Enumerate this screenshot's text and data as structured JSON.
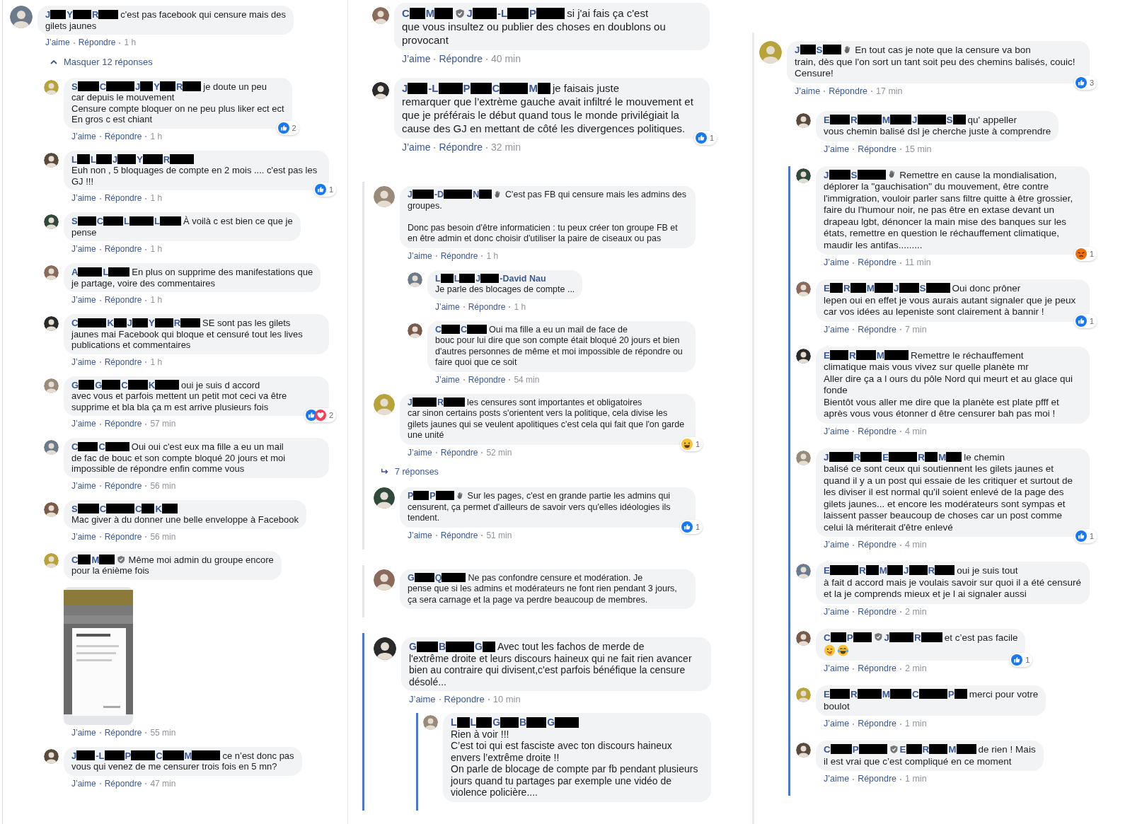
{
  "columns": [
    {
      "items": [
        {
          "kind": "comment",
          "author": [
            {
              "kind": "initial",
              "text": "J"
            },
            {
              "kind": "initial",
              "text": "Y"
            },
            {
              "kind": "initial",
              "text": "R"
            }
          ],
          "head": "c'est pas facebook qui censure mais des",
          "text": "gilets jaunes",
          "actions": {
            "like": "J’aime",
            "reply": "Répondre",
            "time": "1 h"
          },
          "children": [
            {
              "kind": "toggle",
              "expanded": true,
              "label": "Masquer 12 réponses"
            },
            {
              "kind": "comment",
              "author": [
                {
                  "kind": "initial",
                  "text": "S"
                },
                {
                  "kind": "initial",
                  "text": "C"
                },
                {
                  "kind": "initial",
                  "text": "J"
                },
                {
                  "kind": "initial",
                  "text": "Y"
                },
                {
                  "kind": "initial",
                  "text": "R"
                }
              ],
              "head": "je doute un peu",
              "text": "car depuis le mouvement\nCensure compte bloquer on ne peu plus liker ect ect\nEn gros c est chiant",
              "actions": {
                "like": "J’aime",
                "reply": "Répondre",
                "time": "1 h"
              },
              "reaction": {
                "icons": [
                  {
                    "kind": "like"
                  }
                ],
                "count": "2"
              }
            },
            {
              "kind": "comment",
              "author": [
                {
                  "kind": "initial",
                  "text": "L"
                },
                {
                  "kind": "initial",
                  "text": "L"
                },
                {
                  "kind": "initial",
                  "text": "J"
                },
                {
                  "kind": "initial",
                  "text": "Y"
                },
                {
                  "kind": "initial",
                  "text": "R"
                }
              ],
              "text": "Euh non , 5 bloquages de compte en 2 mois .... c'est pas les GJ !!!",
              "actions": {
                "like": "J’aime",
                "reply": "Répondre",
                "time": "1 h"
              },
              "reaction": {
                "icons": [
                  {
                    "kind": "like"
                  }
                ],
                "count": "1"
              }
            },
            {
              "kind": "comment",
              "author": [
                {
                  "kind": "initial",
                  "text": "S"
                },
                {
                  "kind": "initial",
                  "text": "C"
                },
                {
                  "kind": "initial",
                  "text": "L"
                },
                {
                  "kind": "initial",
                  "text": "L"
                }
              ],
              "head": "À voilà c est bien ce que je",
              "text": "pense",
              "actions": {
                "like": "J’aime",
                "reply": "Répondre",
                "time": "1 h"
              }
            },
            {
              "kind": "comment",
              "author": [
                {
                  "kind": "initial",
                  "text": "A"
                },
                {
                  "kind": "initial",
                  "text": "L"
                }
              ],
              "head": "En plus on supprime des manifestations que",
              "text": "je partage, voire des commentaires",
              "actions": {
                "like": "J’aime",
                "reply": "Répondre",
                "time": "1 h"
              }
            },
            {
              "kind": "comment",
              "author": [
                {
                  "kind": "initial",
                  "text": "C"
                },
                {
                  "kind": "initial",
                  "text": "K"
                },
                {
                  "kind": "initial",
                  "text": "J"
                },
                {
                  "kind": "initial",
                  "text": "Y"
                },
                {
                  "kind": "initial",
                  "text": "R"
                }
              ],
              "head": "SE sont pas les gilets",
              "text": "jaunes mai Facebook qui bloque et censuré tout les lives publications et commentaires",
              "actions": {
                "like": "J’aime",
                "reply": "Répondre",
                "time": "1 h"
              }
            },
            {
              "kind": "comment",
              "author": [
                {
                  "kind": "initial",
                  "text": "G"
                },
                {
                  "kind": "initial",
                  "text": "G"
                },
                {
                  "kind": "initial",
                  "text": "C"
                },
                {
                  "kind": "initial",
                  "text": "K"
                }
              ],
              "head": "oui je suis d accord",
              "text": "avec vous et parfois mettent un petit mot ceci va être supprime et bla bla ça m est arrive plusieurs fois",
              "actions": {
                "like": "J’aime",
                "reply": "Répondre",
                "time": "57 min"
              },
              "reaction": {
                "icons": [
                  {
                    "kind": "like"
                  },
                  {
                    "kind": "love"
                  }
                ],
                "count": "2"
              }
            },
            {
              "kind": "comment",
              "author": [
                {
                  "kind": "initial",
                  "text": "C"
                },
                {
                  "kind": "initial",
                  "text": "C"
                }
              ],
              "head": "Oui oui c'est eux ma fille a eu un mail",
              "text": "de fac de bouc et son compte bloqué 20 jours et moi impossible de répondre enfin comme vous",
              "actions": {
                "like": "J’aime",
                "reply": "Répondre",
                "time": "56 min"
              }
            },
            {
              "kind": "comment",
              "author": [
                {
                  "kind": "initial",
                  "text": "S"
                },
                {
                  "kind": "initial",
                  "text": "C"
                },
                {
                  "kind": "initial",
                  "text": "C"
                },
                {
                  "kind": "initial",
                  "text": "K"
                }
              ],
              "text": "Mac giver à du donner une belle enveloppe à Facebook",
              "actions": {
                "like": "J’aime",
                "reply": "Répondre",
                "time": "56 min"
              }
            },
            {
              "kind": "comment",
              "author": [
                {
                  "kind": "initial",
                  "text": "C"
                },
                {
                  "kind": "initial",
                  "text": "M"
                },
                {
                  "kind": "admin"
                }
              ],
              "head": "Même moi admin du groupe encore",
              "text": "pour la énième fois",
              "attachment": {
                "kind": "picture"
              },
              "actions": {
                "like": "J’aime",
                "reply": "Répondre",
                "time": "55 min"
              }
            },
            {
              "kind": "comment",
              "author": [
                {
                  "kind": "initial",
                  "text": "J"
                },
                {
                  "kind": "initial",
                  "text": "-L"
                },
                {
                  "kind": "initial",
                  "text": "P"
                },
                {
                  "kind": "initial",
                  "text": "C"
                },
                {
                  "kind": "initial",
                  "text": "M"
                }
              ],
              "head": "ce n’est donc pas",
              "text": "vous qui venez de me censurer trois fois en 5 mn?",
              "actions": {
                "like": "J’aime",
                "reply": "Répondre",
                "time": "47 min"
              }
            }
          ]
        }
      ]
    },
    {
      "items": [
        {
          "kind": "comment",
          "author": [
            {
              "kind": "initial",
              "text": "C"
            },
            {
              "kind": "initial",
              "text": "M"
            },
            {
              "kind": "admin"
            },
            {
              "kind": "initial",
              "text": "J"
            },
            {
              "kind": "initial",
              "text": "-L"
            },
            {
              "kind": "initial",
              "text": "P"
            }
          ],
          "head": "si j'ai fais ça c'est",
          "text": "que vous insultez ou publier des choses en doublons ou provocant",
          "actions": {
            "like": "J’aime",
            "reply": "Répondre",
            "time": "40 min"
          }
        },
        {
          "kind": "comment",
          "author": [
            {
              "kind": "initial",
              "text": "J"
            },
            {
              "kind": "initial",
              "text": "-L"
            },
            {
              "kind": "initial",
              "text": "P"
            },
            {
              "kind": "initial",
              "text": "C"
            },
            {
              "kind": "initial",
              "text": "M"
            }
          ],
          "head": "je faisais juste",
          "text": "remarquer que l’extrème gauche avait infiltré le mouvement et que je préférais le début quand tous le monde privilégiait la cause des GJ en mettant de côté les divergences politiques.",
          "actions": {
            "like": "J’aime",
            "reply": "Répondre",
            "time": "32 min"
          },
          "reaction": {
            "icons": [
              {
                "kind": "like"
              }
            ],
            "count": "1"
          }
        },
        {
          "kind": "thread",
          "highlighted": false,
          "items": [
            {
              "kind": "comment",
              "author": [
                {
                  "kind": "initial",
                  "text": "J"
                },
                {
                  "kind": "initial",
                  "text": "-D"
                },
                {
                  "kind": "initial",
                  "text": "N"
                },
                {
                  "kind": "wave"
                }
              ],
              "head": "C'est pas FB qui censure mais les admins des",
              "text": "groupes.\n\nDonc pas besoin d'être informaticien : tu peux créer ton groupe FB et en être admin et donc choisir d'utiliser la paire de ciseaux ou pas",
              "actions": {
                "like": "J’aime",
                "reply": "Répondre",
                "time": "1 h"
              },
              "children": [
                {
                  "kind": "comment",
                  "author": [
                    {
                      "kind": "initial",
                      "text": "L"
                    },
                    {
                      "kind": "initial",
                      "text": "L"
                    },
                    {
                      "kind": "initial",
                      "text": "J"
                    },
                    {
                      "kind": "name",
                      "text": "-David Nau"
                    }
                  ],
                  "text": "Je parle des blocages de compte ...",
                  "actions": {
                    "like": "J’aime",
                    "reply": "Répondre",
                    "time": "1 h"
                  }
                },
                {
                  "kind": "comment",
                  "author": [
                    {
                      "kind": "initial",
                      "text": "C"
                    },
                    {
                      "kind": "initial",
                      "text": "C"
                    }
                  ],
                  "head": "Oui ma fille a eu un mail de face de",
                  "text": "bouc pour lui dire que son compte était bloqué 20 jours et bien d'autres personnes de même et moi impossible de répondre ou faire quoi que ce soit",
                  "actions": {
                    "like": "J’aime",
                    "reply": "Répondre",
                    "time": "54 min"
                  }
                }
              ]
            },
            {
              "kind": "comment",
              "author": [
                {
                  "kind": "initial",
                  "text": "J"
                },
                {
                  "kind": "initial",
                  "text": "R"
                }
              ],
              "head": "les censures sont importantes et obligatoires",
              "text": "car sinon certains posts s'orientent vers la politique, cela divise les gilets jaunes qui se veulent apolitiques c'est cela qui fait que l'on garde une unité",
              "actions": {
                "like": "J’aime",
                "reply": "Répondre",
                "time": "52 min"
              },
              "reaction": {
                "icons": [
                  {
                    "kind": "haha"
                  }
                ],
                "count": "1"
              }
            },
            {
              "kind": "toggle",
              "expanded": false,
              "label": "7 réponses"
            },
            {
              "kind": "comment",
              "author": [
                {
                  "kind": "initial",
                  "text": "P"
                },
                {
                  "kind": "initial",
                  "text": "P"
                },
                {
                  "kind": "wave"
                }
              ],
              "head": "Sur les pages, c'est en grande partie les admins qui",
              "text": "censurent, ça permet d'ailleurs de savoir vers qu'elles idéologies ils tendent.",
              "actions": {
                "like": "J’aime",
                "reply": "Répondre",
                "time": "51 min"
              },
              "reaction": {
                "icons": [
                  {
                    "kind": "like"
                  }
                ],
                "count": "1"
              }
            }
          ]
        },
        {
          "kind": "thread",
          "highlighted": false,
          "items": [
            {
              "kind": "comment",
              "author": [
                {
                  "kind": "initial",
                  "text": "G"
                },
                {
                  "kind": "initial",
                  "text": "Q"
                }
              ],
              "head": "Ne pas confondre censure et modération. Je",
              "text": "pense que si les admins et modérateurs ne font rien pendant 3 jours, ça sera carnage et la page va perdre beaucoup de membres."
            }
          ]
        },
        {
          "kind": "thread",
          "highlighted": true,
          "items": [
            {
              "kind": "comment",
              "author": [
                {
                  "kind": "initial",
                  "text": "G"
                },
                {
                  "kind": "initial",
                  "text": "B"
                },
                {
                  "kind": "initial",
                  "text": "G"
                }
              ],
              "head": "Avec tout les fachos de merde de",
              "text": "l'extrême droite et leurs discours haineux qui ne fait rien avancer bien au contraire qui divisent,c'est parfois bénéfique la censure désolé...",
              "actions": {
                "like": "J’aime",
                "reply": "Répondre",
                "time": "10 min"
              },
              "children": [
                {
                  "kind": "thread",
                  "highlighted": true,
                  "items": [
                    {
                      "kind": "comment",
                      "author": [
                        {
                          "kind": "initial",
                          "text": "L"
                        },
                        {
                          "kind": "initial",
                          "text": "L"
                        },
                        {
                          "kind": "initial",
                          "text": "G"
                        },
                        {
                          "kind": "initial",
                          "text": "B"
                        },
                        {
                          "kind": "initial",
                          "text": "G"
                        }
                      ],
                      "text": "Rien à voir !!!\nC’est toi qui est fasciste avec ton discours haineux envers l’extrême droite !!\nOn parle de blocage de compte par fb pendant plusieurs jours quand tu partages par exemple une vidéo de violence policière...."
                    }
                  ]
                }
              ]
            }
          ]
        }
      ]
    },
    {
      "items": [
        {
          "kind": "comment",
          "author": [
            {
              "kind": "initial",
              "text": "J"
            },
            {
              "kind": "initial",
              "text": "S"
            },
            {
              "kind": "wave"
            }
          ],
          "head": "En tout cas je note que la censure va bon",
          "text": "train, dès que l'on sort un tant soit peu des chemins balisés, couic! Censure!",
          "actions": {
            "like": "J’aime",
            "reply": "Répondre",
            "time": "17 min"
          },
          "reaction": {
            "icons": [
              {
                "kind": "like"
              }
            ],
            "count": "3"
          },
          "children": [
            {
              "kind": "comment",
              "author": [
                {
                  "kind": "initial",
                  "text": "E"
                },
                {
                  "kind": "initial",
                  "text": "R"
                },
                {
                  "kind": "initial",
                  "text": "M"
                },
                {
                  "kind": "initial",
                  "text": "J"
                },
                {
                  "kind": "initial",
                  "text": "S"
                }
              ],
              "head": "qu' appeller",
              "text": "vous chemin balisé dsl je cherche juste à comprendre",
              "actions": {
                "like": "J’aime",
                "reply": "Répondre",
                "time": "15 min"
              }
            },
            {
              "kind": "thread",
              "highlighted": true,
              "items": [
                {
                  "kind": "comment",
                  "author": [
                    {
                      "kind": "initial",
                      "text": "J"
                    },
                    {
                      "kind": "initial",
                      "text": "S"
                    },
                    {
                      "kind": "wave"
                    }
                  ],
                  "head": "Remettre en cause la mondialisation,",
                  "text": "déplorer la \"gauchisation\" du mouvement, être contre l'immigration, vouloir parler sans filtre quitte à être grossier, faire du l'humour noir, ne pas être en extase devant un drapeau lgbt, dénoncer la main mise des banques sur les états, remettre en question le réchauffement climatique, maudir les antifas.........",
                  "actions": {
                    "like": "J’aime",
                    "reply": "Répondre",
                    "time": "11 min"
                  },
                  "reaction": {
                    "icons": [
                      {
                        "kind": "angry"
                      }
                    ],
                    "count": "1"
                  }
                },
                {
                  "kind": "comment",
                  "author": [
                    {
                      "kind": "initial",
                      "text": "E"
                    },
                    {
                      "kind": "initial",
                      "text": "R"
                    },
                    {
                      "kind": "initial",
                      "text": "M"
                    },
                    {
                      "kind": "initial",
                      "text": "J"
                    },
                    {
                      "kind": "initial",
                      "text": "S"
                    }
                  ],
                  "head": "Oui donc prôner",
                  "text": "lepen oui en effet je vous aurais autant signaler que je peux car vos idées au lepeniste sont clairement à bannir !",
                  "actions": {
                    "like": "J’aime",
                    "reply": "Répondre",
                    "time": "7 min"
                  },
                  "reaction": {
                    "icons": [
                      {
                        "kind": "like"
                      }
                    ],
                    "count": "1"
                  }
                },
                {
                  "kind": "comment",
                  "author": [
                    {
                      "kind": "initial",
                      "text": "E"
                    },
                    {
                      "kind": "initial",
                      "text": "R"
                    },
                    {
                      "kind": "initial",
                      "text": "M"
                    }
                  ],
                  "head": "Remettre le réchauffement",
                  "text": "climatique mais vous vivez sur quelle planète mr\nAller dire ça a l ours du pôle Nord qui meurt et au glace qui fonde\nBientôt vous aller me dire que la planète est plate pfff et après vous vous étonner d être censurer bah pas moi !",
                  "actions": {
                    "like": "J’aime",
                    "reply": "Répondre",
                    "time": "4 min"
                  }
                },
                {
                  "kind": "comment",
                  "author": [
                    {
                      "kind": "initial",
                      "text": "J"
                    },
                    {
                      "kind": "initial",
                      "text": "R"
                    },
                    {
                      "kind": "initial",
                      "text": "E"
                    },
                    {
                      "kind": "initial",
                      "text": "R"
                    },
                    {
                      "kind": "initial",
                      "text": "M"
                    }
                  ],
                  "head": "le chemin",
                  "text": "balisé ce sont ceux qui soutiennent les gilets jaunes et quand il y a un post qui essaie de les critiquer et surtout de les diviser il est normal qu'il soient enlevé de la page des gilets jaunes... et encore les modérateurs sont sympas et laissent passer beaucoup de choses car un post comme celui là mériterait d'être enlevé",
                  "actions": {
                    "like": "J’aime",
                    "reply": "Répondre",
                    "time": "4 min"
                  },
                  "reaction": {
                    "icons": [
                      {
                        "kind": "like"
                      }
                    ],
                    "count": "1"
                  }
                },
                {
                  "kind": "comment",
                  "author": [
                    {
                      "kind": "initial",
                      "text": "E"
                    },
                    {
                      "kind": "initial",
                      "text": "R"
                    },
                    {
                      "kind": "initial",
                      "text": "M"
                    },
                    {
                      "kind": "initial",
                      "text": "J"
                    },
                    {
                      "kind": "initial",
                      "text": "R"
                    }
                  ],
                  "head": "oui je suis tout",
                  "text": "à fait d accord mais je voulais savoir sur quoi il a été censuré et la je comprends mieux et je l ai signaler aussi",
                  "actions": {
                    "like": "J’aime",
                    "reply": "Répondre",
                    "time": "2 min"
                  }
                },
                {
                  "kind": "comment",
                  "author": [
                    {
                      "kind": "initial",
                      "text": "C"
                    },
                    {
                      "kind": "initial",
                      "text": "P"
                    },
                    {
                      "kind": "admin"
                    },
                    {
                      "kind": "initial",
                      "text": "J"
                    },
                    {
                      "kind": "initial",
                      "text": "R"
                    }
                  ],
                  "head": "et c’est pas facile",
                  "emojis": [
                    {
                      "kind": "wink"
                    },
                    {
                      "kind": "joy"
                    }
                  ],
                  "actions": {
                    "like": "J’aime",
                    "reply": "Répondre",
                    "time": "2 min"
                  },
                  "reaction": {
                    "icons": [
                      {
                        "kind": "like"
                      }
                    ],
                    "count": "1"
                  }
                },
                {
                  "kind": "comment",
                  "author": [
                    {
                      "kind": "initial",
                      "text": "E"
                    },
                    {
                      "kind": "initial",
                      "text": "R"
                    },
                    {
                      "kind": "initial",
                      "text": "M"
                    },
                    {
                      "kind": "initial",
                      "text": "C"
                    },
                    {
                      "kind": "initial",
                      "text": "P"
                    }
                  ],
                  "head": "merci pour votre",
                  "text": "boulot",
                  "actions": {
                    "like": "J’aime",
                    "reply": "Répondre",
                    "time": "1 min"
                  }
                },
                {
                  "kind": "comment",
                  "author": [
                    {
                      "kind": "initial",
                      "text": "C"
                    },
                    {
                      "kind": "initial",
                      "text": "P"
                    },
                    {
                      "kind": "admin"
                    },
                    {
                      "kind": "initial",
                      "text": "E"
                    },
                    {
                      "kind": "initial",
                      "text": "R"
                    },
                    {
                      "kind": "initial",
                      "text": "M"
                    }
                  ],
                  "head": "de rien ! Mais",
                  "text": "il est vrai que c’est compliqué en ce moment",
                  "actions": {
                    "like": "J’aime",
                    "reply": "Répondre",
                    "time": "1 min"
                  }
                }
              ]
            }
          ]
        }
      ]
    }
  ]
}
